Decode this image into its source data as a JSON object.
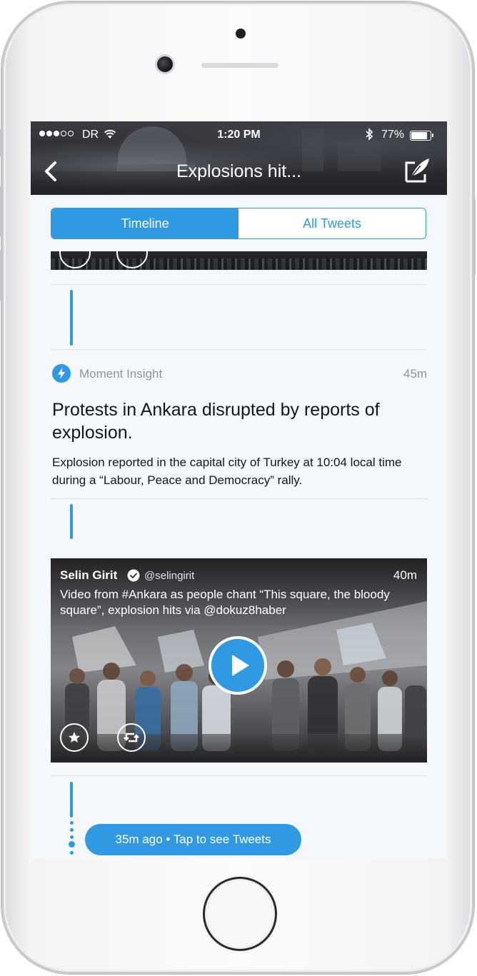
{
  "status_bar": {
    "carrier": "DR",
    "time": "1:20 PM",
    "battery_percent": "77%",
    "battery_level": 0.77
  },
  "nav": {
    "title": "Explosions hit...",
    "back_icon": "chevron-left-icon",
    "compose_icon": "quill-compose-icon"
  },
  "tabs": [
    {
      "label": "Timeline",
      "active": true
    },
    {
      "label": "All Tweets",
      "active": false
    }
  ],
  "insight": {
    "label": "Moment Insight",
    "time": "45m",
    "title": "Protests in Ankara disrupted by reports of explosion.",
    "body": "Explosion reported in the capital city of Turkey at 10:04 local time during a “Labour, Peace and Democracy” rally."
  },
  "tweet": {
    "name": "Selin Girit",
    "handle": "@selingirit",
    "time": "40m",
    "text": "Video from #Ankara as people chant “This square, the bloody square”, explosion hits via @dokuz8haber"
  },
  "footer_pill": {
    "text": "35m ago • Tap to see Tweets"
  },
  "colors": {
    "accent": "#2f9ae3",
    "background": "#f5f8fa",
    "text": "#14171a",
    "muted": "#8c959c"
  }
}
